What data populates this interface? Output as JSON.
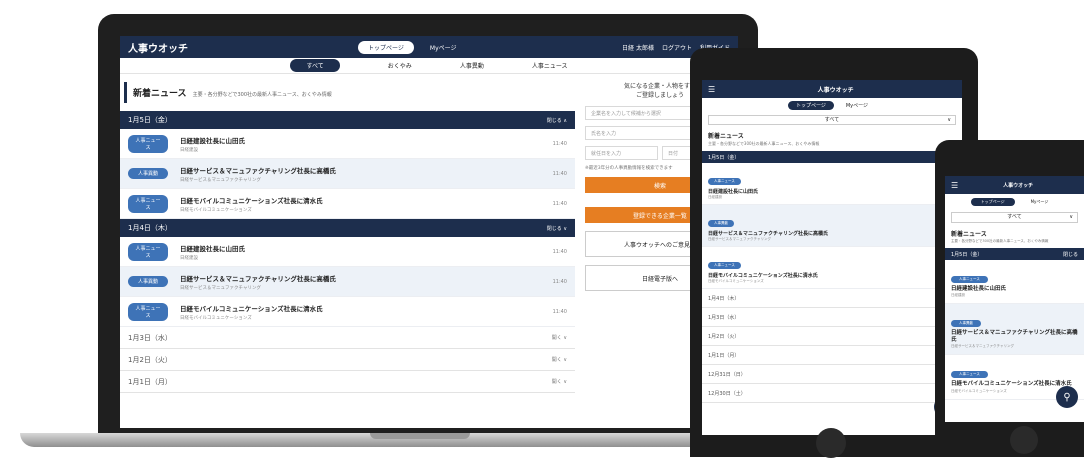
{
  "laptop": {
    "logo": "人事ウオッチ",
    "nav_pills": [
      "トップページ",
      "Myページ"
    ],
    "header_right": [
      "日経 太郎様",
      "ログアウト",
      "利用ガイド"
    ],
    "subnav": [
      "すべて",
      "おくやみ",
      "人事異動",
      "人事ニュース"
    ],
    "section_title": "新着ニュース",
    "section_subtitle": "主要・各分野などで300社の最新人事ニュース、おくやみ情報",
    "date_open_1": {
      "label": "1月5日（金）",
      "toggle": "閉じる ∧"
    },
    "date_open_2": {
      "label": "1月4日（木）",
      "toggle": "閉じる ∨"
    },
    "items_1": [
      {
        "tag": "人事ニュース",
        "title": "日経建設社長に山田氏",
        "sub": "日経建設",
        "time": "11:40"
      },
      {
        "tag": "人事異動",
        "title": "日経サービス＆マニュファクチャリング社長に高橋氏",
        "sub": "日経サービス＆マニュファクチャリング",
        "time": "11:40"
      },
      {
        "tag": "人事ニュース",
        "title": "日経モバイルコミュニケーションズ社長に清水氏",
        "sub": "日経モバイルコミュニケーションズ",
        "time": "11:40"
      }
    ],
    "items_2": [
      {
        "tag": "人事ニュース",
        "title": "日経建設社長に山田氏",
        "sub": "日経建設",
        "time": "11:40"
      },
      {
        "tag": "人事異動",
        "title": "日経サービス＆マニュファクチャリング社長に高橋氏",
        "sub": "日経サービス＆マニュファクチャリング",
        "time": "11:40"
      },
      {
        "tag": "人事ニュース",
        "title": "日経モバイルコミュニケーションズ社長に清水氏",
        "sub": "日経モバイルコミュニケーションズ",
        "time": "11:40"
      }
    ],
    "closed_dates": [
      {
        "label": "1月3日（水）",
        "toggle": "開く ∨"
      },
      {
        "label": "1月2日（火）",
        "toggle": "開く ∨"
      },
      {
        "label": "1月1日（月）",
        "toggle": "開く ∨"
      }
    ],
    "side": {
      "prompt_line1": "気になる企業・人物をすぐ",
      "prompt_line2": "ご登録しましょう",
      "company_placeholder": "企業名を入力して候補から選択",
      "name_placeholder": "氏名を入力",
      "start_placeholder": "就任日を入力",
      "end_placeholder": "日付",
      "note": "※最近3年分の人事異動情報を検索できます",
      "search_button": "検索",
      "register_button": "登録できる企業一覧",
      "link_button": "人事ウオッチへのご意見・",
      "paper_button": "日経電子版へ"
    }
  },
  "tablet": {
    "logo": "人事ウオッチ",
    "pills": [
      "トップページ",
      "Myページ"
    ],
    "select": "すべて",
    "title": "新着ニュース",
    "subtitle": "主要・各分野などで300社の最新人事ニュース、おくやみ情報",
    "date_bar": "1月5日（金）",
    "items": [
      {
        "tag": "人事ニュース",
        "title": "日経建設社長に山田氏",
        "sub": "日経建設"
      },
      {
        "tag": "人事異動",
        "title": "日経サービス＆マニュファクチャリング社長に高橋氏",
        "sub": "日経サービス＆マニュファクチャリング"
      },
      {
        "tag": "人事ニュース",
        "title": "日経モバイルコミュニケーションズ社長に清水氏",
        "sub": "日経モバイルコミュニケーションズ"
      }
    ],
    "dates": [
      "1月4日（木）",
      "1月3日（水）",
      "1月2日（火）",
      "1月1日（月）",
      "12月31日（日）",
      "12月30日（土）"
    ]
  },
  "phone": {
    "logo": "人事ウオッチ",
    "pills": [
      "トップページ",
      "Myページ"
    ],
    "select": "すべて",
    "title": "新着ニュース",
    "subtitle": "主要・各分野などで300社の最新人事ニュース、おくやみ情報",
    "date_bar": "1月5日（金）",
    "date_toggle": "閉じる",
    "items": [
      {
        "tag": "人事ニュース",
        "title": "日経建設社長に山田氏",
        "sub": "日経建設"
      },
      {
        "tag": "人事異動",
        "title": "日経サービス＆マニュファクチャリング社長に高橋氏",
        "sub": "日経サービス＆マニュファクチャリング"
      },
      {
        "tag": "人事ニュース",
        "title": "日経モバイルコミュニケーションズ社長に清水氏",
        "sub": "日経モバイルコミュニケーションズ"
      }
    ]
  },
  "colors": {
    "navy": "#1d2e4d",
    "tag_blue": "#3e73b7",
    "orange": "#e67e22",
    "row_alt": "#edf2f8"
  }
}
